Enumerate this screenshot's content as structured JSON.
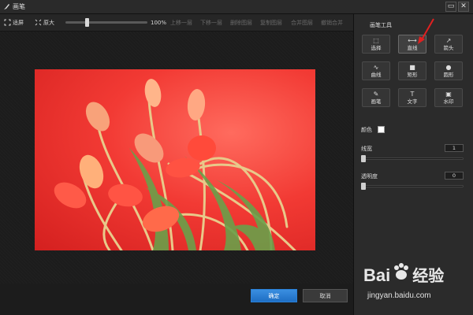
{
  "window": {
    "title": "画笔",
    "min_glyph": "▭",
    "close_glyph": "✕"
  },
  "toolbar": {
    "fit_label": "适屏",
    "original_label": "原大",
    "zoom": "100%",
    "zoom_fraction": 0.25,
    "layer_buttons": [
      "上移一层",
      "下移一层",
      "删除图层",
      "复制图层",
      "合并图层",
      "撤销合并"
    ]
  },
  "canvas": {
    "image_icon": "tulip-photo"
  },
  "actions": {
    "ok_label": "确定",
    "cancel_label": "取消"
  },
  "panel": {
    "title": "画笔工具",
    "tools": [
      {
        "label": "选择",
        "icon": "selection-icon",
        "glyph": "⬚"
      },
      {
        "label": "直线",
        "icon": "line-icon",
        "glyph": "⟷",
        "active": true
      },
      {
        "label": "箭头",
        "icon": "arrow-icon",
        "glyph": "↗"
      },
      {
        "label": "曲线",
        "icon": "curve-icon",
        "glyph": "∿"
      },
      {
        "label": "矩形",
        "icon": "rectangle-icon",
        "glyph": "■"
      },
      {
        "label": "圆形",
        "icon": "circle-icon",
        "glyph": "●"
      },
      {
        "label": "画笔",
        "icon": "brush-icon",
        "glyph": "✎"
      },
      {
        "label": "文字",
        "icon": "text-icon",
        "glyph": "T"
      },
      {
        "label": "水印",
        "icon": "watermark-icon",
        "glyph": "▣"
      }
    ],
    "color_label": "颜色",
    "color_value": "#ffffff",
    "line_width_label": "线宽",
    "line_width_value": "1",
    "line_width_fraction": 0.0,
    "opacity_label": "透明度",
    "opacity_value": "0",
    "opacity_fraction": 0.0
  },
  "watermark": {
    "logo_left": "Bai",
    "logo_right": "经验",
    "url": "jingyan.baidu.com"
  },
  "colors": {
    "accent": "#2a80d8",
    "annotation_arrow": "#e02020"
  }
}
